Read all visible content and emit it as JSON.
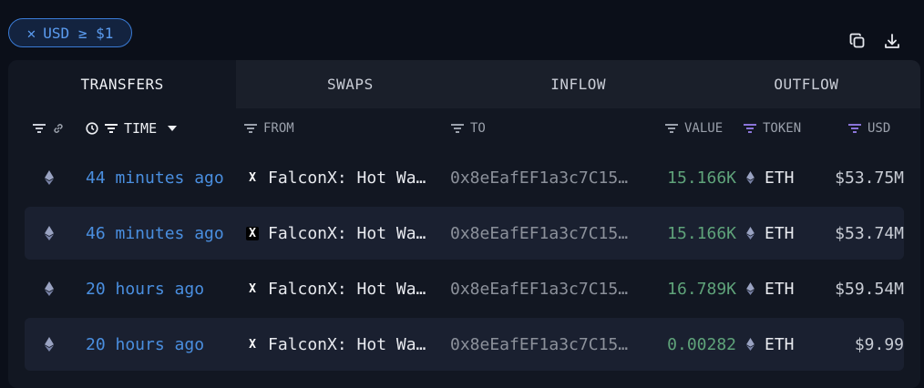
{
  "filter_chip": {
    "label": "USD ≥ $1"
  },
  "tabs": [
    {
      "label": "TRANSFERS",
      "active": true
    },
    {
      "label": "SWAPS",
      "active": false
    },
    {
      "label": "INFLOW",
      "active": false
    },
    {
      "label": "OUTFLOW",
      "active": false
    }
  ],
  "columns": {
    "time": "TIME",
    "from": "FROM",
    "to": "TO",
    "value": "VALUE",
    "token": "TOKEN",
    "usd": "USD"
  },
  "rows": [
    {
      "time": "44 minutes ago",
      "from": "FalconX: Hot Wa…",
      "to": "0x8eEafEF1a3c7C15…",
      "value": "15.166K",
      "token": "ETH",
      "usd": "$53.75M"
    },
    {
      "time": "46 minutes ago",
      "from": "FalconX: Hot Wa…",
      "to": "0x8eEafEF1a3c7C15…",
      "value": "15.166K",
      "token": "ETH",
      "usd": "$53.74M"
    },
    {
      "time": "20 hours ago",
      "from": "FalconX: Hot Wa…",
      "to": "0x8eEafEF1a3c7C15…",
      "value": "16.789K",
      "token": "ETH",
      "usd": "$59.54M"
    },
    {
      "time": "20 hours ago",
      "from": "FalconX: Hot Wa…",
      "to": "0x8eEafEF1a3c7C15…",
      "value": "0.00282",
      "token": "ETH",
      "usd": "$9.99"
    }
  ],
  "colors": {
    "accent": "#4a8fe0",
    "value": "#5fa37a",
    "token_filter": "#8a74d8",
    "background": "#0b0f19"
  }
}
